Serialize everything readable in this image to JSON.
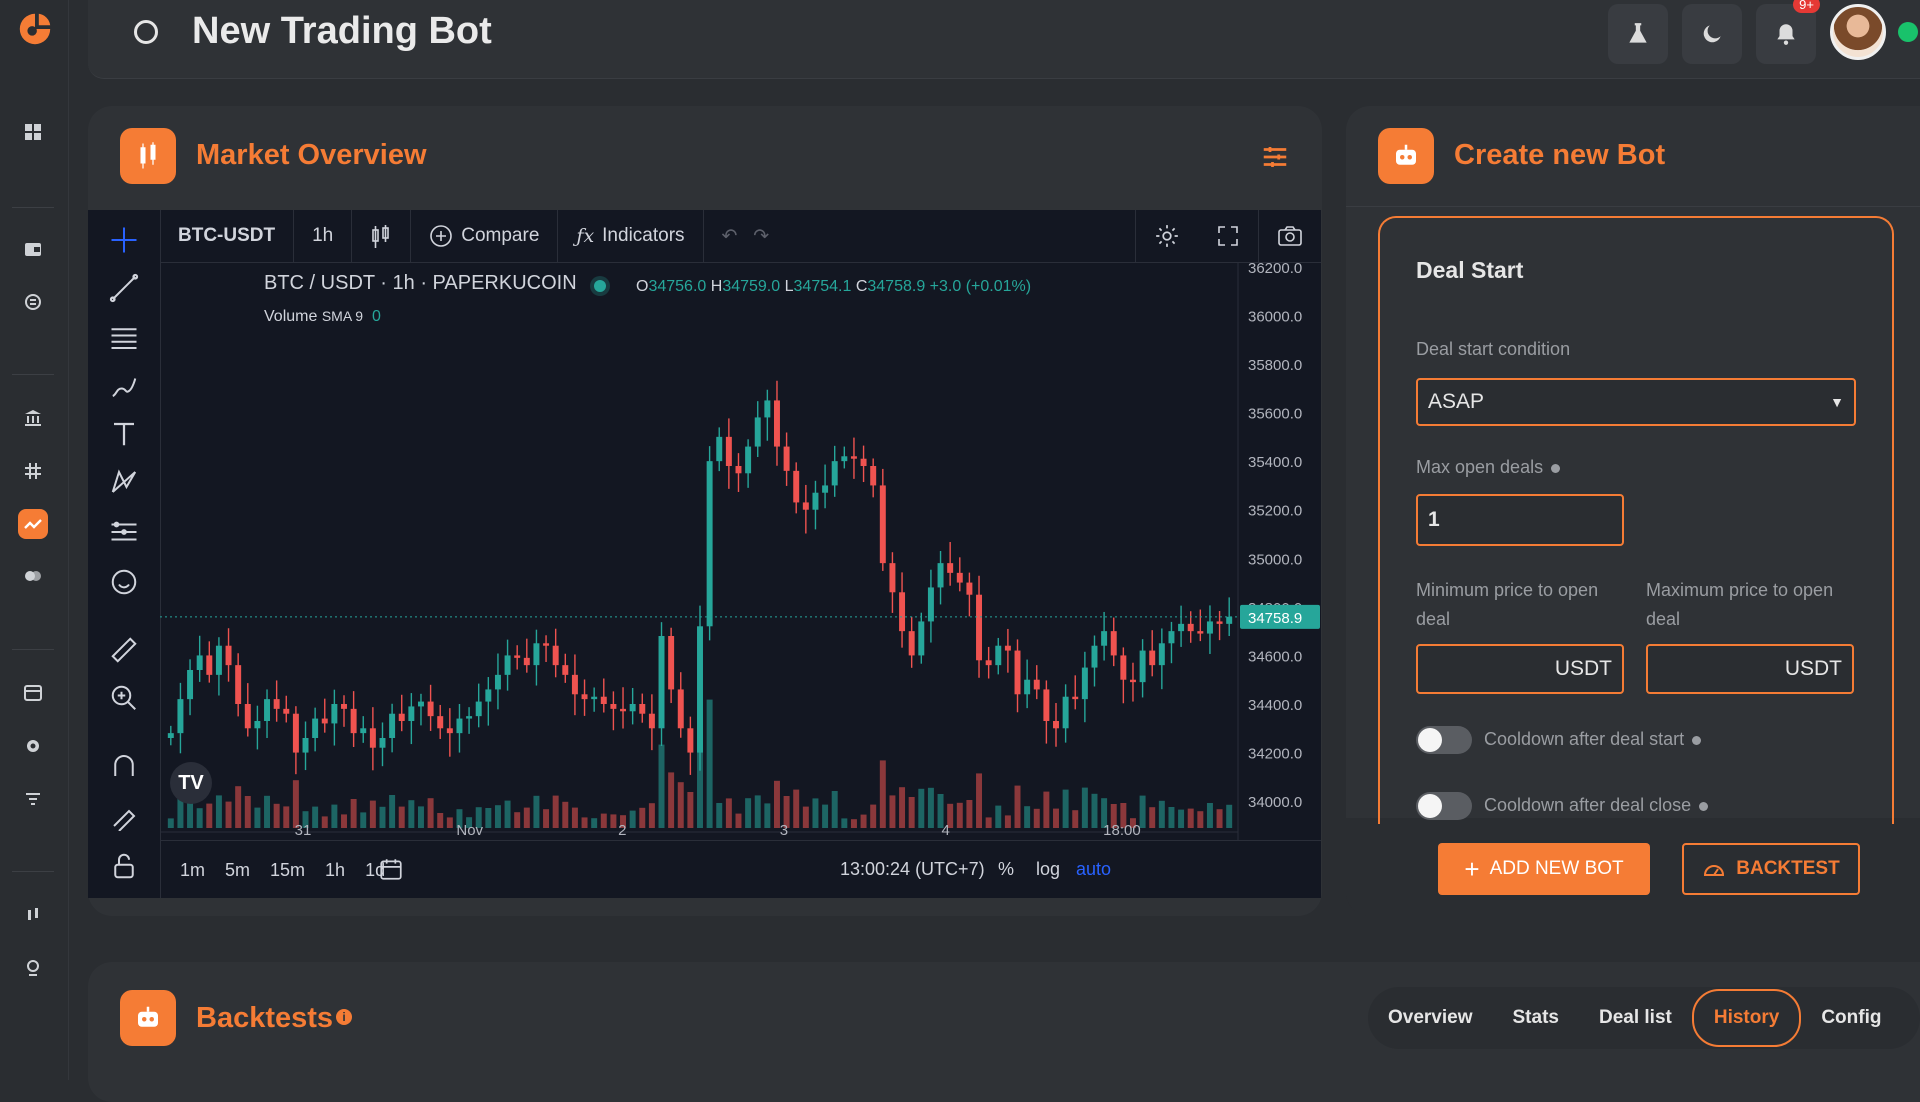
{
  "header": {
    "title": "New Trading Bot",
    "notifications_badge": "9+"
  },
  "market": {
    "title": "Market Overview"
  },
  "chart_toolbar": {
    "symbol": "BTC-USDT",
    "interval": "1h",
    "compare": "Compare",
    "indicators": "Indicators"
  },
  "chart_legend": {
    "pair": "BTC / USDT · 1h · PAPERKUCOIN",
    "o_label": "O",
    "o": "34756.0",
    "h_label": "H",
    "h": "34759.0",
    "l_label": "L",
    "l": "34754.1",
    "c_label": "C",
    "c": "34758.9",
    "change": "+3.0 (+0.01%)",
    "volume": "Volume",
    "sma": "SMA 9",
    "vol_val": "0"
  },
  "chart_bottom": {
    "ranges": [
      "1m",
      "5m",
      "15m",
      "1h",
      "1d"
    ],
    "time": "13:00:24 (UTC+7)",
    "pct": "%",
    "log": "log",
    "auto": "auto"
  },
  "chart_data": {
    "type": "candlestick",
    "symbol": "BTC-USDT",
    "interval": "1h",
    "x_ticks": [
      "31",
      "Nov",
      "2",
      "3",
      "4",
      "18:00"
    ],
    "y_ticks": [
      "36200.0",
      "36000.0",
      "35800.0",
      "35600.0",
      "35400.0",
      "35200.0",
      "35000.0",
      "34800.0",
      "34600.0",
      "34400.0",
      "34200.0",
      "34000.0"
    ],
    "ylim": [
      33840,
      36220
    ],
    "last_price": "34758.9",
    "closes": [
      34280,
      34420,
      34540,
      34600,
      34520,
      34640,
      34560,
      34400,
      34300,
      34330,
      34420,
      34380,
      34360,
      34200,
      34260,
      34340,
      34320,
      34400,
      34380,
      34280,
      34300,
      34220,
      34260,
      34360,
      34330,
      34390,
      34410,
      34350,
      34300,
      34280,
      34340,
      34350,
      34410,
      34460,
      34520,
      34600,
      34590,
      34560,
      34650,
      34640,
      34560,
      34520,
      34440,
      34420,
      34430,
      34400,
      34380,
      34370,
      34400,
      34360,
      34300,
      34680,
      34460,
      34300,
      34200,
      34720,
      35400,
      35500,
      35380,
      35350,
      35460,
      35580,
      35650,
      35460,
      35360,
      35230,
      35200,
      35270,
      35300,
      35400,
      35420,
      35410,
      35380,
      35300,
      34980,
      34860,
      34700,
      34600,
      34740,
      34880,
      34980,
      34940,
      34900,
      34850,
      34580,
      34560,
      34640,
      34620,
      34440,
      34500,
      34460,
      34330,
      34300,
      34430,
      34420,
      34550,
      34640,
      34700,
      34600,
      34500,
      34490,
      34620,
      34560,
      34650,
      34700,
      34730,
      34700,
      34690,
      34740,
      34730,
      34759
    ],
    "volume_label": "Volume SMA 9"
  },
  "bot": {
    "title": "Create new Bot",
    "section": "Deal Start",
    "cond_label": "Deal start condition",
    "cond_value": "ASAP",
    "max_label": "Max open deals",
    "max_value": "1",
    "min_label": "Minimum price to open deal",
    "max_price_label": "Maximum price to open deal",
    "currency": "USDT",
    "cooldown_start": "Cooldown after deal start",
    "cooldown_close": "Cooldown after deal close",
    "add_btn": "ADD NEW BOT",
    "backtest_btn": "BACKTEST"
  },
  "backtests": {
    "title": "Backtests",
    "tabs": [
      "Overview",
      "Stats",
      "Deal list",
      "History",
      "Config"
    ],
    "active_tab": "History"
  },
  "colors": {
    "accent": "#f57c35",
    "up": "#26a69a",
    "down": "#ef5350",
    "chart_bg": "#131722"
  }
}
